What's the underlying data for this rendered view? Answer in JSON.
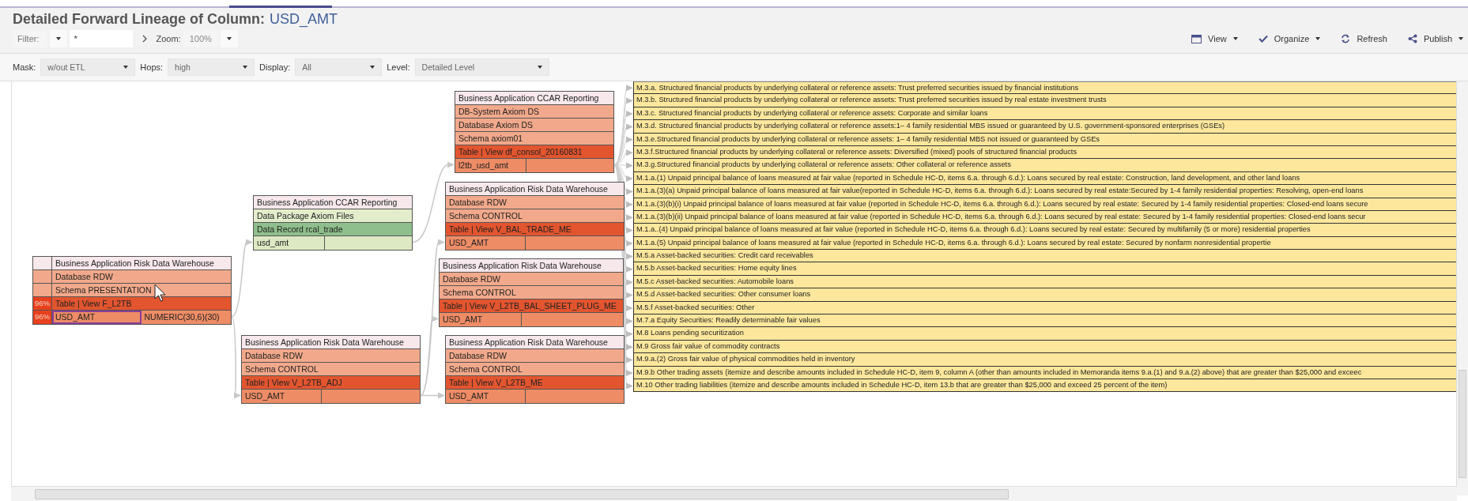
{
  "title": {
    "prefix": "Detailed Forward Lineage of Column:",
    "column": "USD_AMT"
  },
  "filter": {
    "label": "Filter:",
    "value": "*"
  },
  "zoom": {
    "label": "Zoom:",
    "value": "100%"
  },
  "actions": [
    {
      "label": "View",
      "kind": "view",
      "dropdown": true
    },
    {
      "label": "Organize",
      "kind": "organize",
      "dropdown": true
    },
    {
      "label": "Refresh",
      "kind": "refresh",
      "dropdown": false
    },
    {
      "label": "Publish",
      "kind": "publish",
      "dropdown": true
    }
  ],
  "options": [
    {
      "label": "Mask:",
      "value": "w/out ETL"
    },
    {
      "label": "Hops:",
      "value": "high"
    },
    {
      "label": "Display:",
      "value": "All"
    },
    {
      "label": "Level:",
      "value": "Detailed Level"
    }
  ],
  "nodes": [
    {
      "selected": true,
      "rows": [
        {
          "kind": "header",
          "text": "Business Application Risk Data Warehouse"
        },
        {
          "kind": "container",
          "text": "Database RDW"
        },
        {
          "kind": "container",
          "text": "Schema PRESENTATION"
        },
        {
          "kind": "table",
          "text": "Table | View F_L2TB",
          "percent": "96%"
        },
        {
          "kind": "column",
          "text": "USD_AMT",
          "type": "NUMERIC(30,6)(30)",
          "percent": "96%"
        }
      ]
    },
    {
      "selected": false,
      "rows": [
        {
          "kind": "header",
          "text": "Business Application CCAR Reporting"
        },
        {
          "kind": "package",
          "text": "Data Package Axiom Files"
        },
        {
          "kind": "record",
          "text": "Data Record rcal_trade"
        },
        {
          "kind": "field",
          "text": "usd_amt"
        }
      ]
    },
    {
      "selected": false,
      "rows": [
        {
          "kind": "header",
          "text": "Business Application Risk Data Warehouse"
        },
        {
          "kind": "container",
          "text": "Database RDW"
        },
        {
          "kind": "container",
          "text": "Schema CONTROL"
        },
        {
          "kind": "table",
          "text": "Table | View V_L2TB_ADJ"
        },
        {
          "kind": "column",
          "text": "USD_AMT"
        }
      ]
    },
    {
      "selected": false,
      "rows": [
        {
          "kind": "header",
          "text": "Business Application CCAR Reporting"
        },
        {
          "kind": "container",
          "text": "DB-System Axiom DS"
        },
        {
          "kind": "container",
          "text": "Database Axiom DS"
        },
        {
          "kind": "container",
          "text": "Schema axiom01"
        },
        {
          "kind": "table",
          "text": "Table | View df_consol_20160831"
        },
        {
          "kind": "column",
          "text": "l2tb_usd_amt"
        }
      ]
    },
    {
      "selected": false,
      "rows": [
        {
          "kind": "header",
          "text": "Business Application Risk Data Warehouse"
        },
        {
          "kind": "container",
          "text": "Database RDW"
        },
        {
          "kind": "container",
          "text": "Schema CONTROL"
        },
        {
          "kind": "table",
          "text": "Table | View V_BAL_TRADE_ME"
        },
        {
          "kind": "column",
          "text": "USD_AMT"
        }
      ]
    },
    {
      "selected": false,
      "rows": [
        {
          "kind": "header",
          "text": "Business Application Risk Data Warehouse"
        },
        {
          "kind": "container",
          "text": "Database RDW"
        },
        {
          "kind": "container",
          "text": "Schema CONTROL"
        },
        {
          "kind": "table",
          "text": "Table | View V_L2TB_BAL_SHEET_PLUG_ME"
        },
        {
          "kind": "column",
          "text": "USD_AMT"
        }
      ]
    },
    {
      "selected": false,
      "rows": [
        {
          "kind": "header",
          "text": "Business Application Risk Data Warehouse"
        },
        {
          "kind": "container",
          "text": "Database RDW"
        },
        {
          "kind": "container",
          "text": "Schema CONTROL"
        },
        {
          "kind": "table",
          "text": "Table | View V_L2TB_ME"
        },
        {
          "kind": "column",
          "text": "USD_AMT"
        }
      ]
    }
  ],
  "targets": [
    "M.3.a. Structured financial products by underlying collateral or reference assets: Trust preferred securities issued by financial institutions",
    "M.3.b. Structured financial products by underlying collateral or reference assets: Trust preferred securities issued by real estate investment trusts",
    "M.3.c. Structured financial products by underlying collateral or reference assets: Corporate and similar loans",
    "M.3.d. Structured financial products by underlying collateral or reference assets:1– 4 family residential MBS issued or guaranteed by U.S. government-sponsored enterprises (GSEs)",
    "M.3.e.Structured financial products by underlying collateral or reference assets: 1– 4 family residential MBS not issued or guaranteed by GSEs",
    "M.3.f.Structured financial products by underlying collateral or reference assets: Diversified (mixed) pools of structured financial products",
    "M.3.g.Structured financial products by underlying collateral or reference assets: Other collateral or reference assets",
    "M.1.a.(1) Unpaid principal balance of loans measured at fair value (reported in Schedule HC-D, items 6.a. through 6.d.): Loans secured by real estate: Construction, land development, and other land loans",
    "M.1.a.(3)(a) Unpaid principal balance of loans measured at fair value(reported in Schedule HC-D, items 6.a. through 6.d.): Loans secured by real estate:Secured by 1-4 family residential properties: Resolving, open-end loans",
    "M.1.a.(3)(b)(i) Unpaid principal balance of loans measured at fair value (reported in Schedule HC-D, items 6.a. through 6.d.): Loans secured by real estate: Secured by 1-4 family residential properties: Closed-end loans secure",
    "M.1.a.(3)(b)(ii) Unpaid principal balance of loans measured at fair value (reported in Schedule HC-D, items 6.a. through 6.d.): Loans secured by real estate: Secured by 1-4 family residential properties: Closed-end loans secur",
    "M.1.a..(4) Unpaid principal balance of loans measured at fair value (reported in Schedule HC-D, items 6.a. through 6.d.): Loans secured by real estate: Secured by multifamily (5 or more) residential properties",
    "M.1.a.(5) Unpaid principal balance of loans measured at fair value (reported in Schedule HC-D, items 6.a. through 6.d.): Loans secured by real estate: Secured by nonfarm nonresidential propertie",
    "M.5.a Asset-backed securities: Credit card receivables",
    "M.5.b Asset-backed securities: Home equity lines",
    "M.5.c Asset-backed securities: Automobile loans",
    "M.5.d Asset-backed securities: Other consumer loans",
    "M.5.f Asset-backed securities: Other",
    "M.7.a Equity Securities: Readily determinable fair values",
    "M.8 Loans pending securitization",
    "M.9 Gross fair value of commodity contracts",
    "M.9.a.(2) Gross fair value of physical commodities held in inventory",
    "M.9.b Other trading assets (itemize and describe amounts included in Schedule HC-D, item 9, column A (other than amounts included in Memoranda items 9.a.(1) and 9.a.(2) above) that are greater than $25,000 and exceec",
    "M.10 Other trading liabilities (itemize and describe amounts included in Schedule HC-D, item 13.b that are greater than $25,000 and exceed 25 percent of the item)"
  ]
}
